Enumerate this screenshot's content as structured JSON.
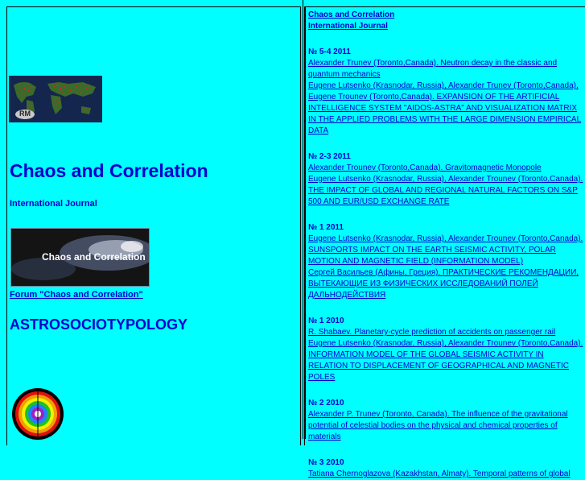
{
  "left": {
    "title": "Chaos and Correlation",
    "subtitle": "International Journal",
    "map_logo_text": "RM",
    "forum_banner_caption": "Chaos and Correlation",
    "forum_link": "Forum \"Chaos and Correlation\"",
    "astro_title": "ASTROSOCIOTYPOLOGY"
  },
  "right": {
    "head_line1": "Chaos and Correlation",
    "head_line2": "International Journal",
    "issues": [
      {
        "number": "№ 5-4 2011",
        "entries": [
          "Alexander Trunev (Toronto,Canada). Neutron decay in the classic and quantum mechanics",
          "Eugene Lutsenko (Krasnodar, Russia), Alexander Trunev (Toronto,Canada), Eugene Trounev (Toronto,Canada). EXPANSION OF THE ARTIFICIAL INTELLIGENCE SYSTEM \"AIDOS-ASTRA\" AND VISUALIZATION MATRIX IN THE APPLIED PROBLEMS WITH THE LARGE DIMENSION EMPIRICAL DATA"
        ]
      },
      {
        "number": "№ 2-3 2011",
        "entries": [
          "Alexander Trounev (Toronto,Canada). Gravitomagnetic Monopole",
          "Eugene Lutsenko (Krasnodar, Russia), Alexander Trounev (Toronto,Canada). THE IMPACT OF GLOBAL AND REGIONAL NATURAL FACTORS ON S&P 500 AND EUR/USD EXCHANGE RATE"
        ]
      },
      {
        "number": "№ 1 2011",
        "entries": [
          "Eugene Lutsenko (Krasnodar, Russia), Alexander Trounev (Toronto,Canada). SUNSPORTS IMPACT ON THE EARTH SEISMIC ACTIVITY, POLAR MOTION AND MAGNETIC FIELD (INFORMATION MODEL)",
          "Сергей Васильев (Афины, Греция). ПРАКТИЧЕСКИЕ РЕКОМЕНДАЦИИ, ВЫТЕКАЮЩИЕ ИЗ ФИЗИЧЕСКИХ ИССЛЕДОВАНИЙ ПОЛЕЙ ДАЛЬНОДЕЙСТВИЯ"
        ]
      },
      {
        "number": "№ 1 2010",
        "entries": [
          "R. Shabaev. Planetary-cycle prediction of accidents on passenger rail",
          "Eugene Lutsenko (Krasnodar, Russia), Alexander Trounev (Toronto,Canada). INFORMATION MODEL OF THE GLOBAL SEISMIC ACTIVITY IN RELATION TO DISPLACEMENT OF GEOGRAPHICAL AND MAGNETIC POLES"
        ]
      },
      {
        "number": "№ 2 2010",
        "entries": [
          "Alexander P. Trunev (Toronto, Canada). The influence of the gravitational potential of celestial bodies on the physical and chemical properties of materials"
        ]
      },
      {
        "number": "№ 3 2010",
        "entries": [
          "Tatiana Chernoglazova (Kazakhstan, Almaty). Temporal patterns of global"
        ]
      }
    ]
  },
  "colors": {
    "background": "#00ffff",
    "link": "#0000cc"
  }
}
